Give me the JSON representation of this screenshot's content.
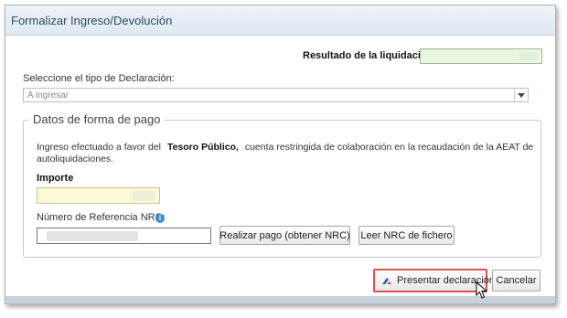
{
  "dialog": {
    "title": "Formalizar Ingreso/Devolución"
  },
  "resultado": {
    "label": "Resultado de la liquidación"
  },
  "declaracion": {
    "label": "Seleccione el tipo de Declaración:",
    "selected": "A ingresar"
  },
  "pago": {
    "legend": "Datos de forma de pago",
    "info_prefix": "Ingreso efectuado a favor del",
    "info_bold": "Tesoro Público,",
    "info_suffix": "cuenta restringida de colaboración en la recaudación de la AEAT de",
    "info_line2": "autoliquidaciones.",
    "importe_label": "Importe",
    "nrc_label": "Número de Referencia  NRC:",
    "realizar_button": "Realizar pago (obtener NRC)",
    "leer_button": "Leer NRC de fichero"
  },
  "footer": {
    "presentar_button": "Presentar declaración",
    "cancelar_button": "Cancelar"
  },
  "icons": {
    "info": "info-icon",
    "dropdown": "chevron-down-icon",
    "presentar": "declaration-icon",
    "cursor": "mouse-pointer-icon"
  },
  "colors": {
    "highlight_field_green": "#e9f7df",
    "highlight_field_yellow": "#fbf8d6",
    "presentar_border": "#d9534f",
    "title_text": "#2d4a6a"
  }
}
